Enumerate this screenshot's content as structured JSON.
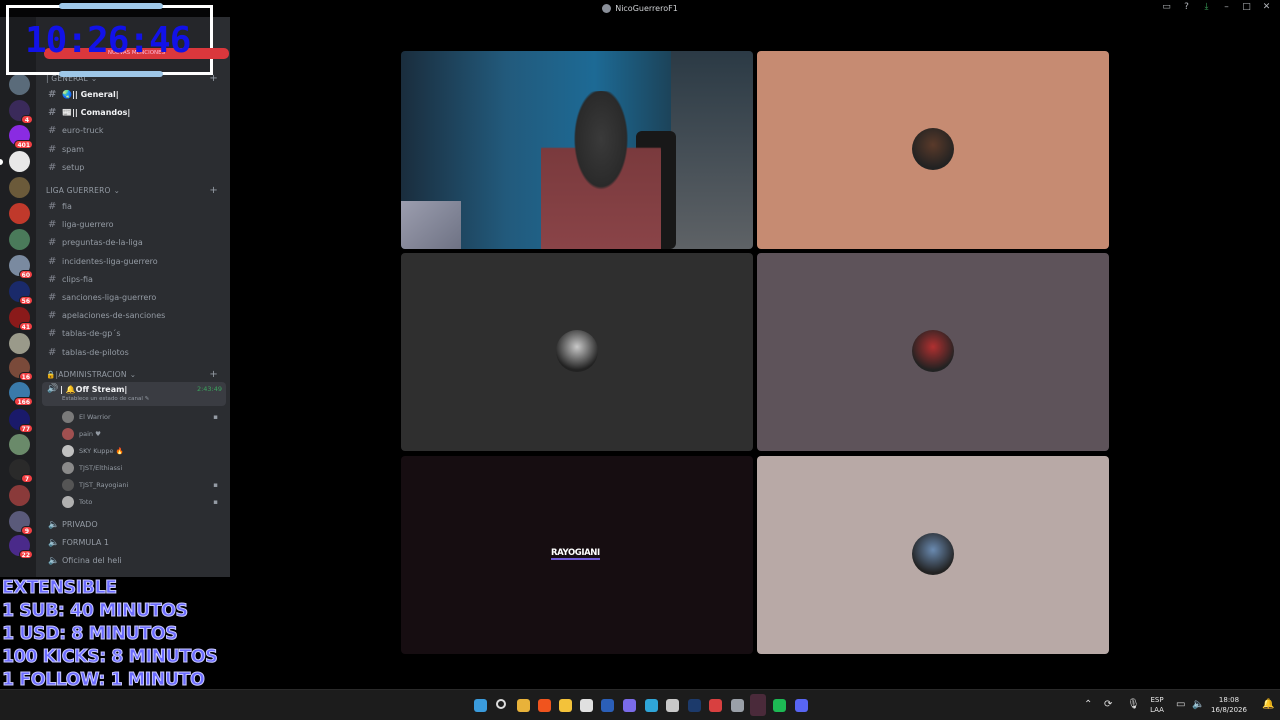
{
  "window": {
    "title": "NicoGuerreroF1",
    "controls": [
      "inbox-icon",
      "help-icon",
      "download-icon",
      "minimize-icon",
      "maximize-icon",
      "close-icon"
    ]
  },
  "overlay": {
    "clock": "10:26:46",
    "mentions_label": "NUEVAS MENCIONES",
    "promo_lines": [
      "EXTENSIBLE",
      "1 SUB: 40 MINUTOS",
      "1 USD: 8 MINUTOS",
      "100 KICKS: 8 MINUTOS",
      "1 FOLLOW: 1 MINUTO"
    ]
  },
  "server_rail": {
    "servers": [
      {
        "color": "#5a6b7a",
        "badge": ""
      },
      {
        "color": "#3a2a5a",
        "badge": "4"
      },
      {
        "color": "#8a2be2",
        "badge": "401"
      },
      {
        "color": "#e8e8e8",
        "badge": ""
      },
      {
        "color": "#6b5a3a",
        "badge": ""
      },
      {
        "color": "#c0392b",
        "badge": ""
      },
      {
        "color": "#4a7a5a",
        "badge": ""
      },
      {
        "color": "#7a8aa0",
        "badge": "60"
      },
      {
        "color": "#1a2a6a",
        "badge": "56"
      },
      {
        "color": "#8a1a1a",
        "badge": "41"
      },
      {
        "color": "#9a9a8a",
        "badge": ""
      },
      {
        "color": "#7a4a3a",
        "badge": "16"
      },
      {
        "color": "#3a7aaa",
        "badge": "166"
      },
      {
        "color": "#1a1a6a",
        "badge": "77"
      },
      {
        "color": "#6a8a6a",
        "badge": ""
      },
      {
        "color": "#2a2a2a",
        "badge": "7"
      },
      {
        "color": "#8a3a3a",
        "badge": ""
      },
      {
        "color": "#5a5a7a",
        "badge": "9"
      },
      {
        "color": "#4a2a8a",
        "badge": "22"
      }
    ]
  },
  "sidebar": {
    "categories": {
      "general": "| GENERAL",
      "liga": "LIGA GUERRERO",
      "admin": "|ADMINISTRACION"
    },
    "general_channels": [
      "🌏|| General|",
      "📰|| Comandos|",
      "euro-truck",
      "spam",
      "setup"
    ],
    "liga_channels": [
      "fia",
      "liga-guerrero",
      "preguntas-de-la-liga",
      "incidentes-liga-guerrero",
      "clips-fia",
      "sanciones-liga-guerrero",
      "apelaciones-de-sanciones",
      "tablas-de-gp´s",
      "tablas-de-pilotos"
    ],
    "active_voice": {
      "name": "| 🔔Off Stream|",
      "timer": "2:43:49",
      "status": "Establece un estado de canal"
    },
    "voice_users": [
      {
        "name": "El Warrior",
        "color": "#7a7a7a",
        "right": "▪"
      },
      {
        "name": "pain ♥",
        "color": "#a05050",
        "right": ""
      },
      {
        "name": "SKY Kuppe 🔥",
        "color": "#c0c0c0",
        "right": ""
      },
      {
        "name": "TJST/Elthiassi",
        "color": "#8a8a8a",
        "right": ""
      },
      {
        "name": "TJST_Rayogiani",
        "color": "#555",
        "right": "▪"
      },
      {
        "name": "Toto",
        "color": "#b0b0b0",
        "right": "▪"
      }
    ],
    "voice_channels": [
      "PRIVADO",
      "FORMULA 1",
      "Oficina del heli"
    ]
  },
  "grid": {
    "tiles": [
      {
        "kind": "camera",
        "bg": "#1d6a95"
      },
      {
        "kind": "avatar",
        "bg": "#c68b72",
        "avatar_color": "#5a3a2a"
      },
      {
        "kind": "avatar",
        "bg": "#2f2f2f",
        "avatar_color": "#c8c8c8"
      },
      {
        "kind": "avatar",
        "bg": "#5e535a",
        "avatar_color": "#b03030"
      },
      {
        "kind": "label",
        "bg": "#160d11",
        "label": "RAYOGIANI"
      },
      {
        "kind": "avatar",
        "bg": "#b8a9a6",
        "avatar_color": "#6a8ab0"
      }
    ]
  },
  "taskbar": {
    "apps": [
      {
        "name": "windows-start-icon",
        "color": "#3a9bdc"
      },
      {
        "name": "search-icon",
        "color": "#ddd"
      },
      {
        "name": "chrome-icon",
        "color": "#e8b23a"
      },
      {
        "name": "brave-icon",
        "color": "#f0541e"
      },
      {
        "name": "file-explorer-icon",
        "color": "#f3c23a"
      },
      {
        "name": "app-icon",
        "color": "#e0e0e0"
      },
      {
        "name": "word-icon",
        "color": "#2b5fb8"
      },
      {
        "name": "copilot-icon",
        "color": "#7a6be8"
      },
      {
        "name": "edge-icon",
        "color": "#2fa5d8"
      },
      {
        "name": "widget-icon",
        "color": "#c8c8c8"
      },
      {
        "name": "photoshop-icon",
        "color": "#1c3a6b"
      },
      {
        "name": "app2-icon",
        "color": "#d84040"
      },
      {
        "name": "steam-icon",
        "color": "#9aa0a8"
      },
      {
        "name": "discord-active-icon",
        "color": "#c03060"
      },
      {
        "name": "spotify-icon",
        "color": "#1db954"
      },
      {
        "name": "discord-icon",
        "color": "#5865f2"
      }
    ],
    "language_top": "ESP",
    "language_bottom": "LAA",
    "time": "18:08",
    "date": "16/8/2026"
  }
}
